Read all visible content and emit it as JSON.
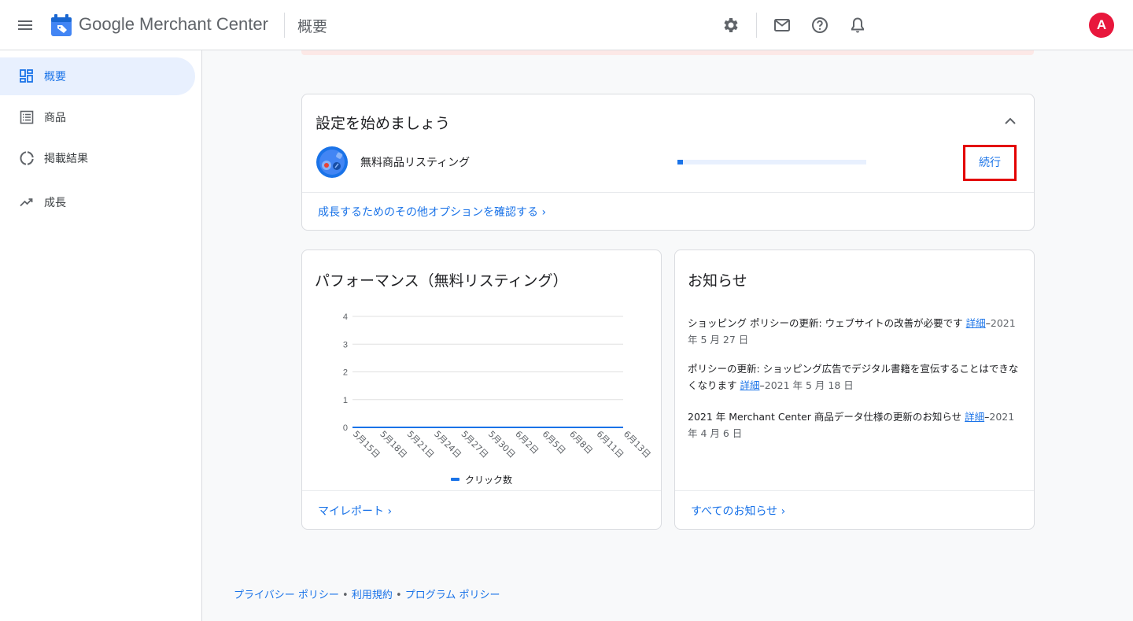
{
  "header": {
    "brand": "Google Merchant Center",
    "page_title": "概要",
    "avatar_letter": "A",
    "icons": [
      "menu-icon",
      "settings-icon",
      "mail-icon",
      "help-icon",
      "notifications-icon"
    ]
  },
  "sidebar": {
    "items": [
      {
        "label": "概要",
        "icon": "dashboard-icon",
        "active": true
      },
      {
        "label": "商品",
        "icon": "list-icon",
        "active": false
      },
      {
        "label": "掲載結果",
        "icon": "donut-icon",
        "active": false
      },
      {
        "label": "成長",
        "icon": "trending-up-icon",
        "active": false
      }
    ]
  },
  "setup": {
    "title": "設定を始めましょう",
    "listing_label": "無料商品リスティング",
    "progress_fraction": 0.03,
    "continue_label": "続行",
    "more_options_link": "成長するためのその他オプションを確認する"
  },
  "performance": {
    "title": "パフォーマンス（無料リスティング）",
    "my_report_link": "マイレポート"
  },
  "chart_data": {
    "type": "line",
    "x": [
      "5月15日",
      "5月18日",
      "5月21日",
      "5月24日",
      "5月27日",
      "5月30日",
      "6月2日",
      "6月5日",
      "6月8日",
      "6月11日",
      "6月13日"
    ],
    "series": [
      {
        "name": "クリック数",
        "values": [
          0,
          0,
          0,
          0,
          0,
          0,
          0,
          0,
          0,
          0,
          0
        ],
        "color": "#1a73e8"
      }
    ],
    "y_ticks": [
      "0",
      "1",
      "2",
      "3",
      "4"
    ],
    "ylim": [
      0,
      4
    ],
    "grid": true,
    "legend_position": "bottom"
  },
  "news": {
    "title": "お知らせ",
    "items": [
      {
        "text": "ショッピング ポリシーの更新: ウェブサイトの改善が必要です ",
        "link": "詳細",
        "date": "2021 年 5 月 27 日"
      },
      {
        "text": "ポリシーの更新: ショッピング広告でデジタル書籍を宣伝することはできなくなります ",
        "link": "詳細",
        "date": "2021 年 5 月 18 日"
      },
      {
        "text": "2021 年 Merchant Center 商品データ仕様の更新のお知らせ ",
        "link": "詳細",
        "date": "2021 年 4 月 6 日"
      }
    ],
    "all_link": "すべてのお知らせ"
  },
  "footer": {
    "privacy": "プライバシー ポリシー",
    "terms": "利用規約",
    "program": "プログラム ポリシー",
    "separator": " • "
  },
  "colors": {
    "accent": "#1a73e8",
    "avatar": "#e8173c",
    "highlight_border": "#e30000"
  }
}
